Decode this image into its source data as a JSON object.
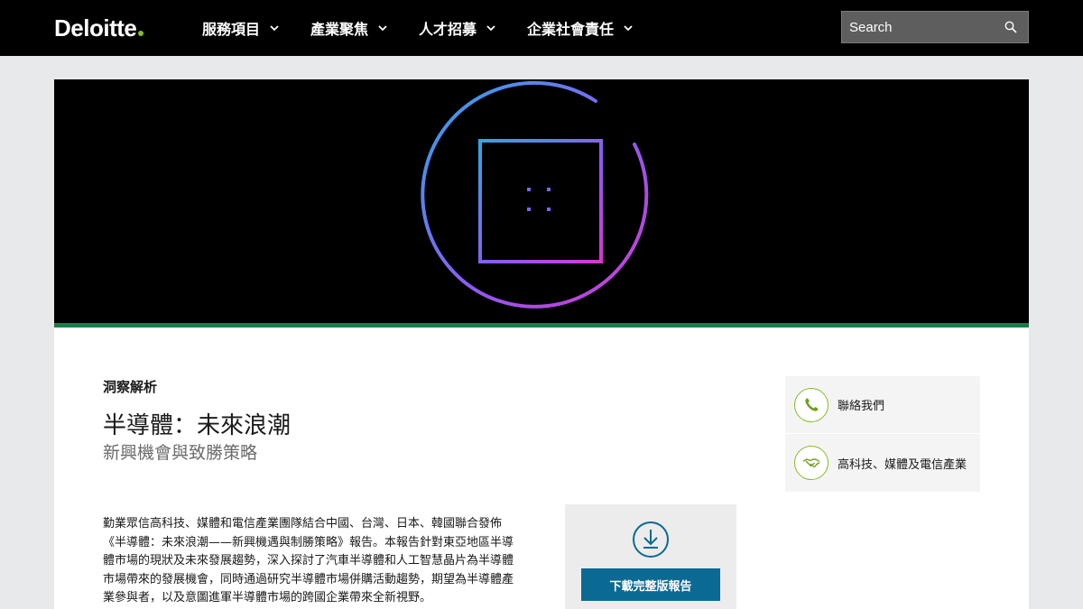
{
  "header": {
    "logo": "Deloitte",
    "nav": [
      {
        "label": "服務項目"
      },
      {
        "label": "產業聚焦"
      },
      {
        "label": "人才招募"
      },
      {
        "label": "企業社會責任"
      }
    ],
    "search_placeholder": "Search"
  },
  "hero": {
    "colors": {
      "start": "#2fa6e8",
      "mid": "#8a5cf0",
      "end": "#d23ad2"
    }
  },
  "article": {
    "eyebrow": "洞察解析",
    "title": "半導體：未來浪潮",
    "subtitle": "新興機會與致勝策略",
    "body": "勤業眾信高科技、媒體和電信產業團隊結合中國、台灣、日本、韓國聯合發佈《半導體：未來浪潮——新興機遇與制勝策略》報告。本報告針對東亞地區半導體市場的現狀及未來發展趨勢，深入探討了汽車半導體和人工智慧晶片為半導體市場帶來的發展機會，同時通過研究半導體市場併購活動趨勢，期望為半導體產業參與者，以及意圖進軍半導體市場的跨國企業帶來全新視野。"
  },
  "download": {
    "button_label": "下載完整版報告"
  },
  "sidebar": {
    "items": [
      {
        "label": "聯絡我們",
        "icon": "phone-icon"
      },
      {
        "label": "高科技、媒體及電信產業",
        "icon": "handshake-icon"
      }
    ]
  },
  "colors": {
    "accent_green": "#86bc25",
    "button_blue": "#0b6a94",
    "hero_bar": "#1f7a47"
  }
}
